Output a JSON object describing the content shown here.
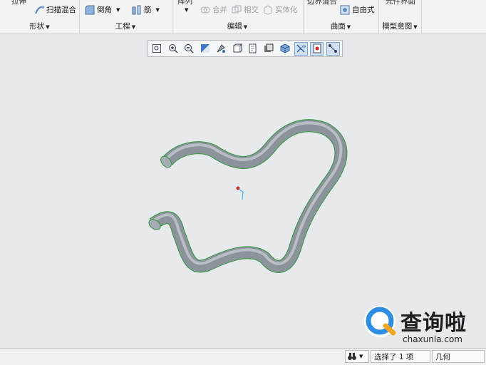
{
  "ribbon": {
    "groups": {
      "shape": "形状",
      "engineering": "工程",
      "editing": "编辑",
      "surfaces": "曲面",
      "model_intent": "模型意图"
    },
    "cut_labels": {
      "extrude": "拉伸",
      "pattern": "阵列",
      "boundary_blend": "边界混合",
      "component_interface": "元件界面"
    },
    "buttons": {
      "swept_blend": "扫描混合",
      "round": "倒角",
      "rib": "筋",
      "merge": "合并",
      "intersect": "相交",
      "solidify": "实体化",
      "freestyle": "自由式"
    }
  },
  "view_toolbar": {
    "icons": [
      "zoom-fit-icon",
      "zoom-in-icon",
      "zoom-out-icon",
      "repaint-icon",
      "view-manager-icon",
      "shading-icon",
      "saved-views-icon",
      "display-style-icon",
      "appearance-icon",
      "datum-display-icon",
      "spin-center-icon",
      "annotation-display-icon"
    ],
    "active": [
      9,
      10,
      11
    ]
  },
  "status": {
    "selection": "选择了 1 项",
    "filter": "几何"
  },
  "watermark": {
    "main": "查询啦",
    "sub": "chaxunla.com"
  },
  "colors": {
    "tube": "#9aa0a8",
    "edge_highlight": "#2e9a3a",
    "background": "#e8e9ec",
    "brand_blue": "#2f8de4",
    "brand_orange": "#f5a623"
  }
}
